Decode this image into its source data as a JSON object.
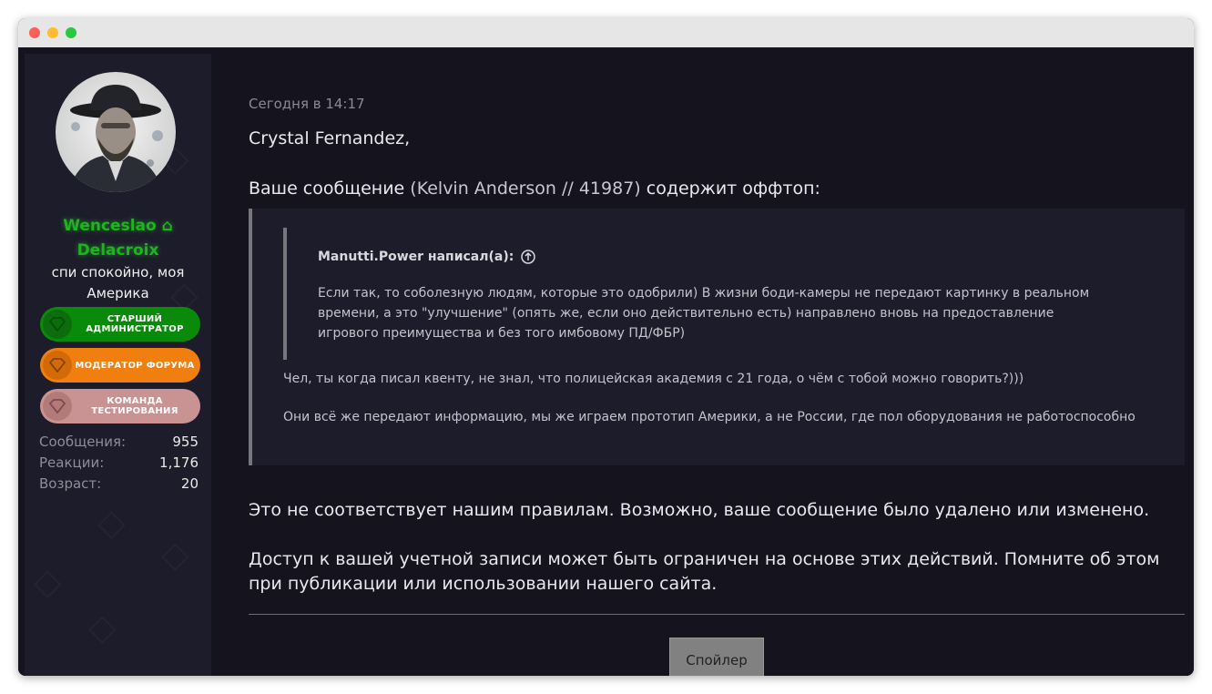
{
  "window": {
    "controls": [
      "close",
      "minimize",
      "maximize"
    ]
  },
  "sidebar": {
    "avatar_alt": "avatar",
    "username_first": "Wenceslao",
    "username_last": "Delacroix",
    "user_icon": "home-icon",
    "user_title": "спи спокойно, моя Америка",
    "badges": [
      {
        "label": "СТАРШИЙ АДМИНИСТРАТОР",
        "color": "#0a8a0a",
        "gem_color": "#0b6d0b",
        "icon": "diamond-icon"
      },
      {
        "label": "МОДЕРАТОР ФОРУМА",
        "color": "#f07f10",
        "gem_color": "#d26a08",
        "icon": "diamond-icon"
      },
      {
        "label": "КОМАНДА ТЕСТИРОВАНИЯ",
        "color": "#c99393",
        "gem_color": "#b37a7a",
        "icon": "diamond-icon"
      }
    ],
    "stats": [
      {
        "label": "Сообщения:",
        "value": "955"
      },
      {
        "label": "Реакции:",
        "value": "1,176"
      },
      {
        "label": "Возраст:",
        "value": "20"
      }
    ]
  },
  "post": {
    "date": "Сегодня в 14:17",
    "greeting": "Crystal Fernandez,",
    "intro_before": "Ваше сообщение ",
    "intro_ref": "(Kelvin Anderson // 41987)",
    "intro_after": " содержит оффтоп:",
    "quote": {
      "author": "Manutti.Power написал(а):",
      "author_icon": "arrow-up-circle-icon",
      "text": "Если так, то соболезную людям, которые это одобрили) В жизни боди-камеры не передают картинку в реальном времени, а это \"улучшение\" (опять же, если оно действительно есть) направлено вновь на предоставление игрового преимущества и без того имбовому ПД/ФБР)"
    },
    "reply_lines": [
      "Чел, ты когда писал квенту, не знал, что полицейская академия с 21 года, о чём с тобой можно говорить?)))",
      "Они всё же передают информацию, мы же играем прототип Америки, а не России, где пол оборудования не работоспособно"
    ],
    "rules_text": "Это не соответствует нашим правилам. Возможно, ваше сообщение было удалено или изменено.",
    "access_text": "Доступ к вашей учетной записи может быть ограничен на основе этих действий. Помните об этом при публикации или использовании нашего сайта.",
    "spoiler_label": "Спойлер"
  }
}
